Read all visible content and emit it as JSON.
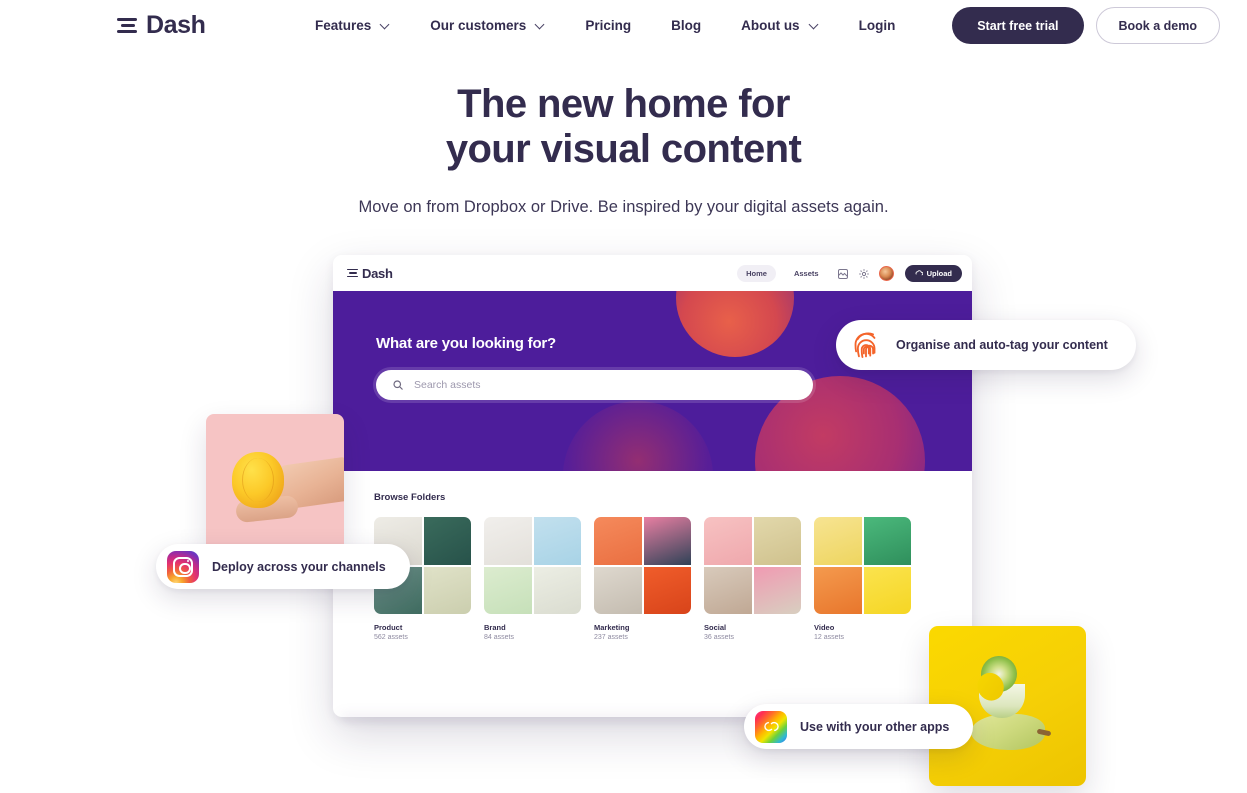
{
  "brand": {
    "name": "Dash",
    "logo_icon": "dash-bars-logo"
  },
  "nav": {
    "items": [
      {
        "label": "Features",
        "has_dropdown": true
      },
      {
        "label": "Our customers",
        "has_dropdown": true
      },
      {
        "label": "Pricing",
        "has_dropdown": false
      },
      {
        "label": "Blog",
        "has_dropdown": false
      },
      {
        "label": "About us",
        "has_dropdown": true
      },
      {
        "label": "Login",
        "has_dropdown": false
      }
    ],
    "cta_primary": "Start free trial",
    "cta_secondary": "Book a demo"
  },
  "hero": {
    "title_line1": "The new home for",
    "title_line2": "your visual content",
    "subtitle": "Move on from Dropbox or Drive. Be inspired by your digital assets again."
  },
  "mockup": {
    "brand_name": "Dash",
    "tabs": [
      {
        "label": "Home",
        "active": true
      },
      {
        "label": "Assets",
        "active": false
      }
    ],
    "icons": [
      "library-icon",
      "gear-icon",
      "avatar"
    ],
    "upload_label": "Upload",
    "search_heading": "What are you looking for?",
    "search_placeholder": "Search assets",
    "browse_title": "Browse Folders",
    "folders": [
      {
        "name": "Product",
        "count": "562 assets",
        "tiles": [
          "#e3e0da",
          "#2e5b4f",
          "#5e8478",
          "#d9dcc4"
        ]
      },
      {
        "name": "Brand",
        "count": "84 assets",
        "tiles": [
          "#ececea",
          "#b3d9e8",
          "#d5e5cf",
          "#e6e7e1"
        ]
      },
      {
        "name": "Marketing",
        "count": "237 assets",
        "tiles": [
          "#f07a4b",
          "#2b3d52",
          "#d8d2c7",
          "#e8562a"
        ]
      },
      {
        "name": "Social",
        "count": "36 assets",
        "tiles": [
          "#f2b7b7",
          "#d9cfa6",
          "#cdbfae",
          "#ef7fa0"
        ]
      },
      {
        "name": "Video",
        "count": "12 assets",
        "tiles": [
          "#f2dd6b",
          "#3ea36a",
          "#ef8a3d",
          "#f7da3b"
        ]
      }
    ]
  },
  "pills": [
    {
      "label": "Organise and auto-tag your content",
      "icon": "fingerprint-icon"
    },
    {
      "label": "Deploy across your channels",
      "icon": "instagram-icon"
    },
    {
      "label": "Use with your other apps",
      "icon": "adobe-creative-cloud-icon"
    }
  ],
  "colors": {
    "ink": "#332c4e",
    "mock_purple": "#4d1d9b",
    "fingerprint_orange": "#f4642a",
    "card_pink": "#f6c4c4",
    "card_yellow": "#fbd900"
  }
}
